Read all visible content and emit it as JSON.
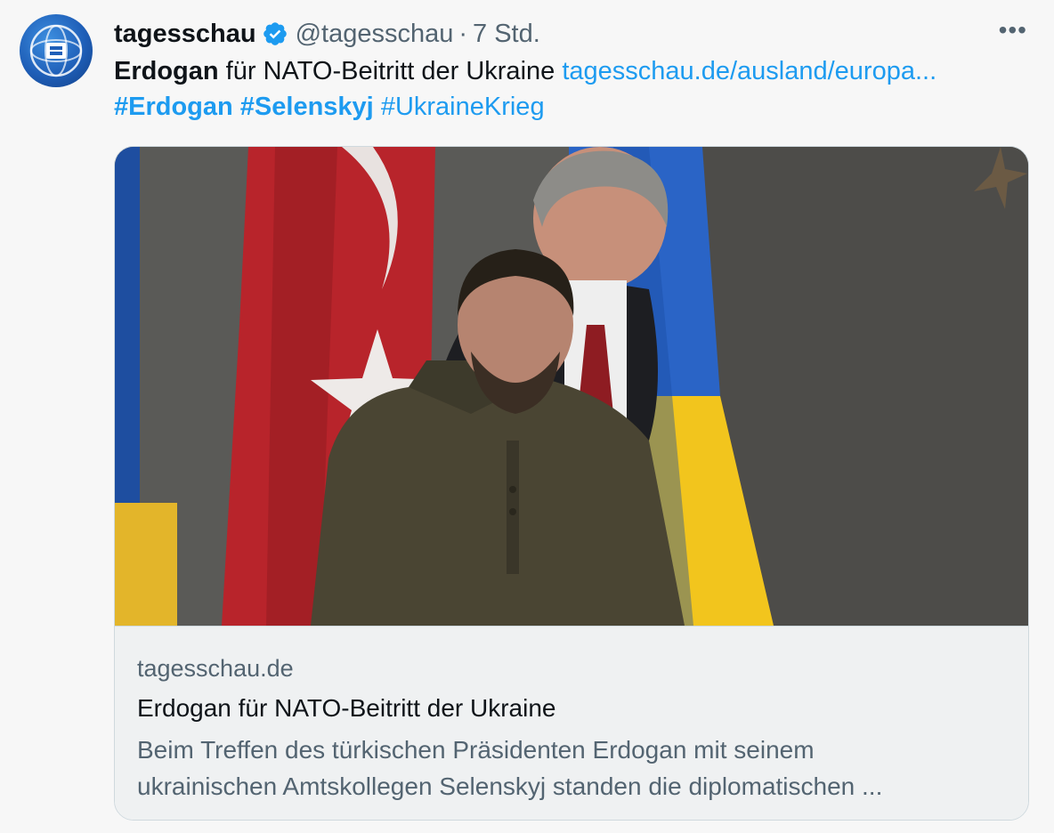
{
  "tweet": {
    "author_name": "tagesschau",
    "author_handle": "@tagesschau",
    "separator": "·",
    "time": "7 Std.",
    "more_label": "•••",
    "text_bold": "Erdogan",
    "text_rest": " für NATO-Beitritt der Ukraine ",
    "link_text": "tagesschau.de/ausland/europa...",
    "hashtags_bold": "#Erdogan #Selenskyj",
    "hashtag_regular": "#UkraineKrieg"
  },
  "card": {
    "domain": "tagesschau.de",
    "title": "Erdogan für NATO-Beitritt der Ukraine",
    "description_line1": "Beim Treffen des türkischen Präsidenten Erdogan mit seinem",
    "description_line2": "ukrainischen Amtskollegen Selenskyj standen die diplomatischen ..."
  },
  "colors": {
    "link": "#1d9bf0",
    "verified": "#1d9bf0",
    "muted": "#536471",
    "background": "#f7f7f7"
  },
  "icons": {
    "avatar": "tagesschau-logo-icon",
    "verified": "verified-badge-icon",
    "more": "more-options-icon"
  }
}
